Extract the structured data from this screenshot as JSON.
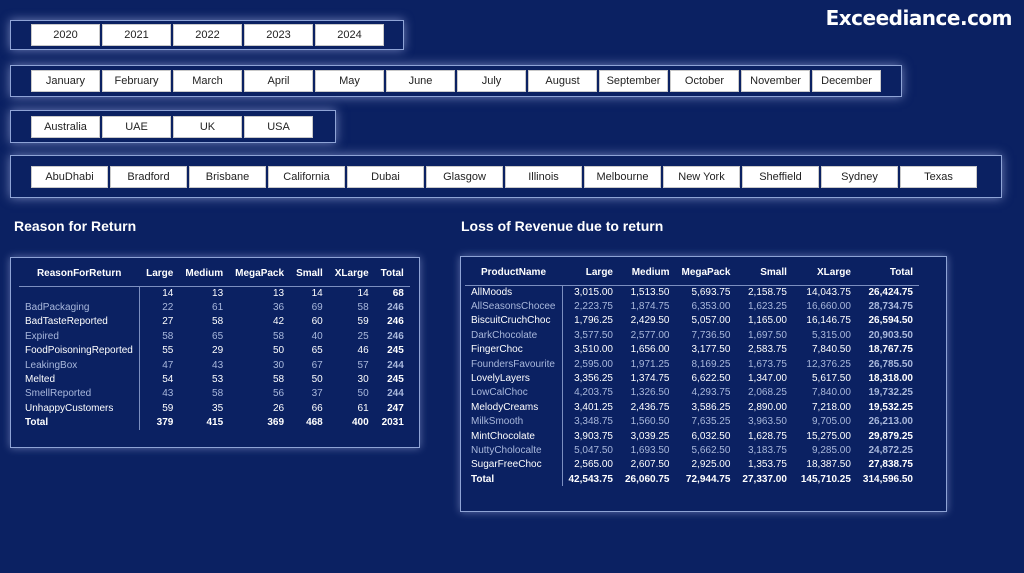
{
  "brand": "Exceediance.com",
  "slicers": {
    "years": [
      "2020",
      "2021",
      "2022",
      "2023",
      "2024"
    ],
    "months": [
      "January",
      "February",
      "March",
      "April",
      "May",
      "June",
      "July",
      "August",
      "September",
      "October",
      "November",
      "December"
    ],
    "countries": [
      "Australia",
      "UAE",
      "UK",
      "USA"
    ],
    "cities": [
      "AbuDhabi",
      "Bradford",
      "Brisbane",
      "California",
      "Dubai",
      "Glasgow",
      "Illinois",
      "Melbourne",
      "New York",
      "Sheffield",
      "Sydney",
      "Texas"
    ]
  },
  "returns": {
    "title": "Reason for Return",
    "headers": [
      "ReasonForReturn",
      "Large",
      "Medium",
      "MegaPack",
      "Small",
      "XLarge",
      "Total"
    ],
    "rows": [
      {
        "label": "",
        "dim": false,
        "values": [
          "14",
          "13",
          "13",
          "14",
          "14",
          "68"
        ]
      },
      {
        "label": "BadPackaging",
        "dim": true,
        "values": [
          "22",
          "61",
          "36",
          "69",
          "58",
          "246"
        ]
      },
      {
        "label": "BadTasteReported",
        "dim": false,
        "values": [
          "27",
          "58",
          "42",
          "60",
          "59",
          "246"
        ]
      },
      {
        "label": "Expired",
        "dim": true,
        "values": [
          "58",
          "65",
          "58",
          "40",
          "25",
          "246"
        ]
      },
      {
        "label": "FoodPoisoningReported",
        "dim": false,
        "values": [
          "55",
          "29",
          "50",
          "65",
          "46",
          "245"
        ]
      },
      {
        "label": "LeakingBox",
        "dim": true,
        "values": [
          "47",
          "43",
          "30",
          "67",
          "57",
          "244"
        ]
      },
      {
        "label": "Melted",
        "dim": false,
        "values": [
          "54",
          "53",
          "58",
          "50",
          "30",
          "245"
        ]
      },
      {
        "label": "SmellReported",
        "dim": true,
        "values": [
          "43",
          "58",
          "56",
          "37",
          "50",
          "244"
        ]
      },
      {
        "label": "UnhappyCustomers",
        "dim": false,
        "values": [
          "59",
          "35",
          "26",
          "66",
          "61",
          "247"
        ]
      }
    ],
    "total": {
      "label": "Total",
      "values": [
        "379",
        "415",
        "369",
        "468",
        "400",
        "2031"
      ]
    }
  },
  "revenue": {
    "title": "Loss of Revenue due to return",
    "headers": [
      "ProductName",
      "Large",
      "Medium",
      "MegaPack",
      "Small",
      "XLarge",
      "Total"
    ],
    "rows": [
      {
        "label": "AllMoods",
        "dim": false,
        "values": [
          "3,015.00",
          "1,513.50",
          "5,693.75",
          "2,158.75",
          "14,043.75",
          "26,424.75"
        ]
      },
      {
        "label": "AllSeasonsChocee",
        "dim": true,
        "values": [
          "2,223.75",
          "1,874.75",
          "6,353.00",
          "1,623.25",
          "16,660.00",
          "28,734.75"
        ]
      },
      {
        "label": "BiscuitCruchChoc",
        "dim": false,
        "values": [
          "1,796.25",
          "2,429.50",
          "5,057.00",
          "1,165.00",
          "16,146.75",
          "26,594.50"
        ]
      },
      {
        "label": "DarkChocolate",
        "dim": true,
        "values": [
          "3,577.50",
          "2,577.00",
          "7,736.50",
          "1,697.50",
          "5,315.00",
          "20,903.50"
        ]
      },
      {
        "label": "FingerChoc",
        "dim": false,
        "values": [
          "3,510.00",
          "1,656.00",
          "3,177.50",
          "2,583.75",
          "7,840.50",
          "18,767.75"
        ]
      },
      {
        "label": "FoundersFavourite",
        "dim": true,
        "values": [
          "2,595.00",
          "1,971.25",
          "8,169.25",
          "1,673.75",
          "12,376.25",
          "26,785.50"
        ]
      },
      {
        "label": "LovelyLayers",
        "dim": false,
        "values": [
          "3,356.25",
          "1,374.75",
          "6,622.50",
          "1,347.00",
          "5,617.50",
          "18,318.00"
        ]
      },
      {
        "label": "LowCalChoc",
        "dim": true,
        "values": [
          "4,203.75",
          "1,326.50",
          "4,293.75",
          "2,068.25",
          "7,840.00",
          "19,732.25"
        ]
      },
      {
        "label": "MelodyCreams",
        "dim": false,
        "values": [
          "3,401.25",
          "2,436.75",
          "3,586.25",
          "2,890.00",
          "7,218.00",
          "19,532.25"
        ]
      },
      {
        "label": "MilkSmooth",
        "dim": true,
        "values": [
          "3,348.75",
          "1,560.50",
          "7,635.25",
          "3,963.50",
          "9,705.00",
          "26,213.00"
        ]
      },
      {
        "label": "MintChocolate",
        "dim": false,
        "values": [
          "3,903.75",
          "3,039.25",
          "6,032.50",
          "1,628.75",
          "15,275.00",
          "29,879.25"
        ]
      },
      {
        "label": "NuttyCholocalte",
        "dim": true,
        "values": [
          "5,047.50",
          "1,693.50",
          "5,662.50",
          "3,183.75",
          "9,285.00",
          "24,872.25"
        ]
      },
      {
        "label": "SugarFreeChoc",
        "dim": false,
        "values": [
          "2,565.00",
          "2,607.50",
          "2,925.00",
          "1,353.75",
          "18,387.50",
          "27,838.75"
        ]
      }
    ],
    "total": {
      "label": "Total",
      "values": [
        "42,543.75",
        "26,060.75",
        "72,944.75",
        "27,337.00",
        "145,710.25",
        "314,596.50"
      ]
    }
  }
}
